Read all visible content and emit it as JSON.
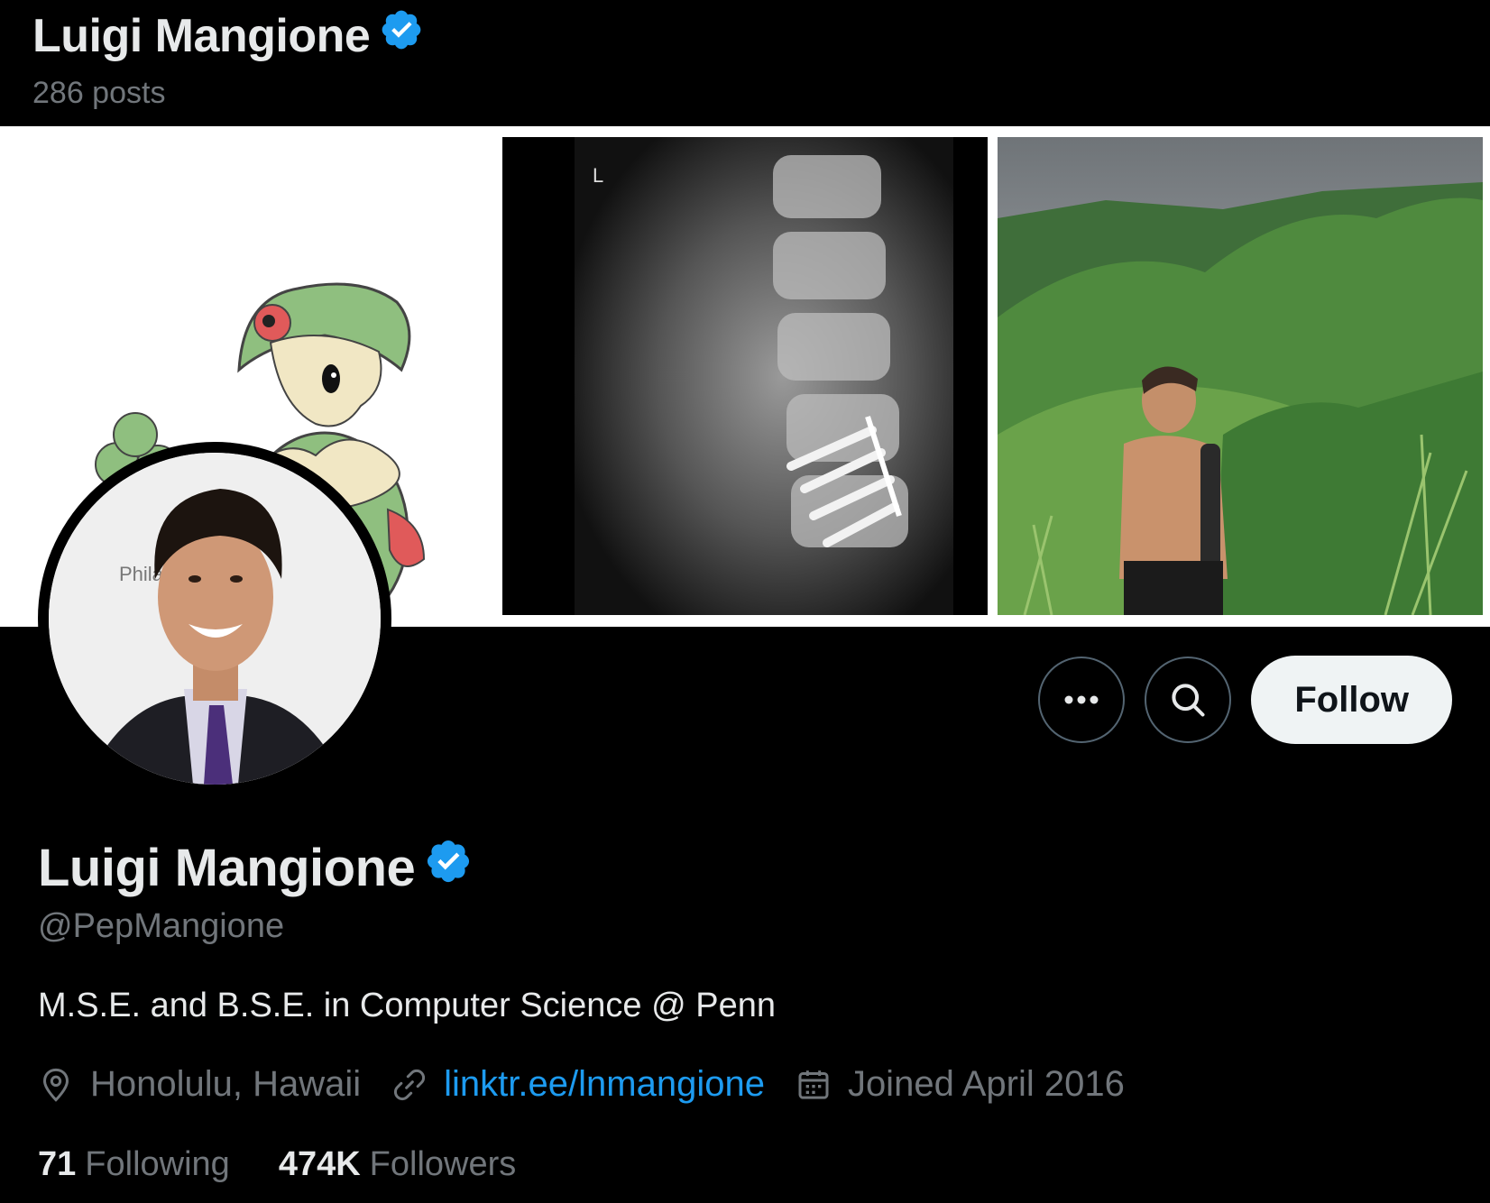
{
  "header": {
    "name": "Luigi Mangione",
    "posts": "286 posts"
  },
  "banner": {
    "images": [
      "pokemon-illustration",
      "spine-xray",
      "hiker-mountain-photo"
    ],
    "avatar_sign_text": "Philad Museu",
    "xray_marker": "L"
  },
  "actions": {
    "more_icon": "ellipsis-icon",
    "search_icon": "search-icon",
    "follow_label": "Follow"
  },
  "profile": {
    "name": "Luigi Mangione",
    "handle": "@PepMangione",
    "bio": "M.S.E. and B.S.E. in Computer Science @ Penn",
    "location": "Honolulu, Hawaii",
    "link": "linktr.ee/lnmangione",
    "joined": "Joined April 2016"
  },
  "stats": {
    "following_count": "71",
    "following_label": "Following",
    "followers_count": "474K",
    "followers_label": "Followers"
  },
  "colors": {
    "background": "#000000",
    "text": "#e7e9ea",
    "muted": "#71767b",
    "link": "#1d9bf0",
    "verified": "#1d9bf0"
  }
}
